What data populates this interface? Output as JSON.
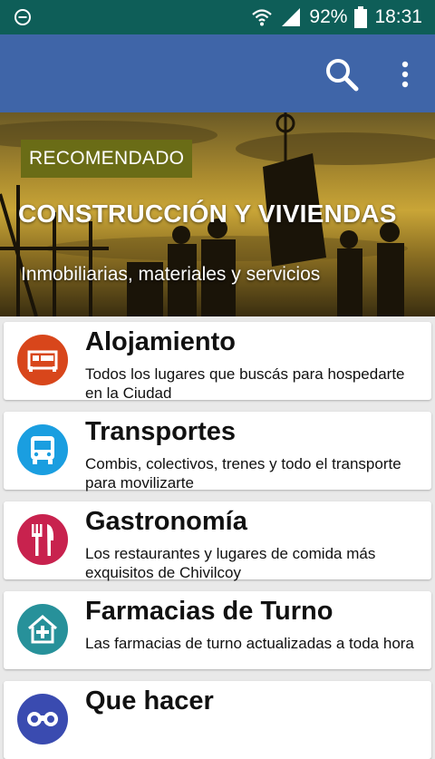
{
  "status_bar": {
    "battery": "92%",
    "time": "18:31"
  },
  "app_bar": {
    "search_icon": "search-icon",
    "menu_icon": "more-vert-icon"
  },
  "hero": {
    "badge": "RECOMENDADO",
    "title": "CONSTRUCCIÓN Y VIVIENDAS",
    "subtitle": "Inmobiliarias, materiales y servicios"
  },
  "categories": [
    {
      "title": "Alojamiento",
      "description": "Todos los lugares que buscás para hospedarte en la Ciudad",
      "icon": "bed-icon",
      "color": "#d8461b"
    },
    {
      "title": "Transportes",
      "description": "Combis, colectivos, trenes y todo el transporte para movilizarte",
      "icon": "bus-icon",
      "color": "#1a9ee0"
    },
    {
      "title": "Gastronomía",
      "description": "Los restaurantes y lugares de comida más exquisitos de Chivilcoy",
      "icon": "fork-knife-icon",
      "color": "#c8224e"
    },
    {
      "title": "Farmacias de Turno",
      "description": "Las farmacias de turno actualizadas a toda hora",
      "icon": "pharmacy-house-icon",
      "color": "#27919a"
    },
    {
      "title": "Que hacer",
      "description": "",
      "icon": "binoculars-icon",
      "color": "#3a4bb0"
    }
  ]
}
